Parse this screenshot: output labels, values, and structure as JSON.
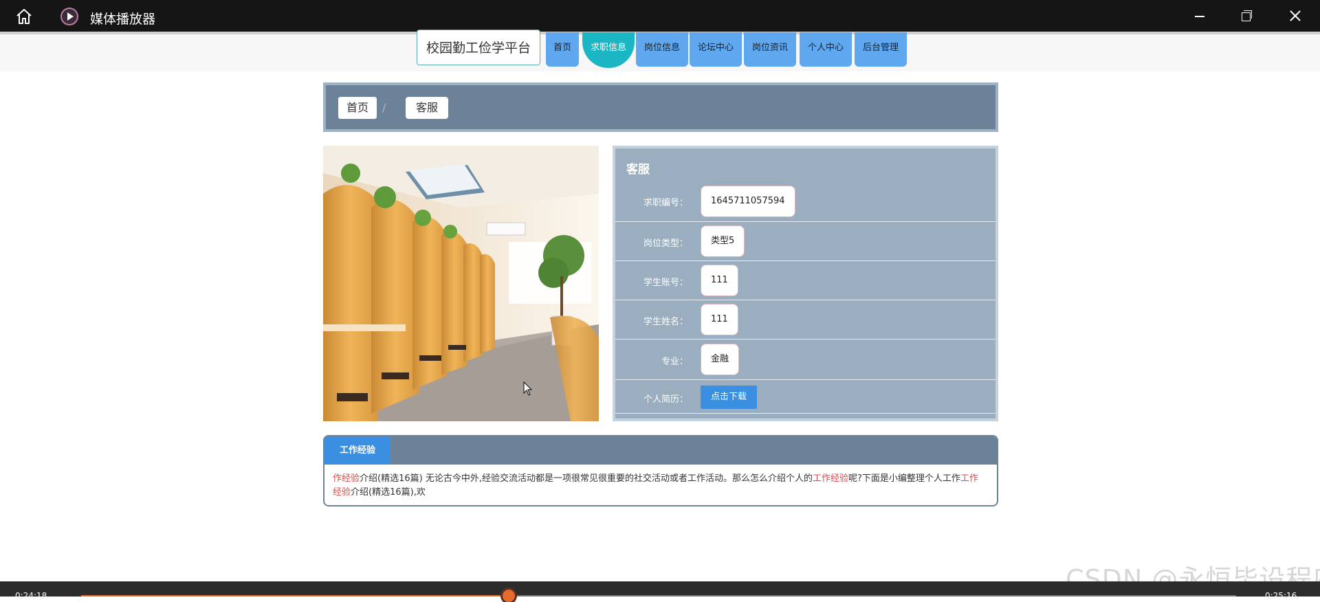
{
  "window": {
    "title": "媒体播放器",
    "home_icon": "home-icon",
    "app_icon": "media-player-icon"
  },
  "site": {
    "brand": "校园勤工俭学平台",
    "nav": [
      {
        "label": "首页"
      },
      {
        "label": "求职信息",
        "active": true
      },
      {
        "label": "岗位信息"
      },
      {
        "label": "论坛中心"
      },
      {
        "label": "岗位资讯"
      },
      {
        "label": "个人中心"
      },
      {
        "label": "后台管理"
      }
    ]
  },
  "breadcrumb": {
    "home": "首页",
    "separator": "/",
    "current": "客服"
  },
  "detail": {
    "title": "客服",
    "fields": [
      {
        "label": "求职编号：",
        "value": "1645711057594"
      },
      {
        "label": "岗位类型：",
        "value": "类型5"
      },
      {
        "label": "学生账号：",
        "value": "111"
      },
      {
        "label": "学生姓名：",
        "value": "111"
      },
      {
        "label": "专业：",
        "value": "金融"
      }
    ],
    "resume": {
      "label": "个人简历：",
      "button": "点击下载"
    }
  },
  "experience": {
    "tab": "工作经验",
    "text": [
      {
        "t": "作经验",
        "hl": true
      },
      {
        "t": "介绍(精选16篇) 无论古今中外,经验交流活动都是一项很常见很重要的社交活动或者工作活动。那么怎么介绍个人的",
        "hl": false
      },
      {
        "t": "工作经验",
        "hl": true
      },
      {
        "t": "呢?下面是小编整理个人工作",
        "hl": false
      },
      {
        "t": "工作经验",
        "hl": true
      },
      {
        "t": "介绍(精选16篇),欢",
        "hl": false
      }
    ]
  },
  "player": {
    "elapsed": "0:24:18",
    "total": "0:25:16",
    "progress": 0.37
  },
  "watermark": "CSDN @永恒毕设程序",
  "colors": {
    "accent": "#3a8fe0",
    "nav_active": "#1ab6c4",
    "panel": "#9aaebf",
    "header": "#6b8298",
    "highlight": "#e04848"
  }
}
